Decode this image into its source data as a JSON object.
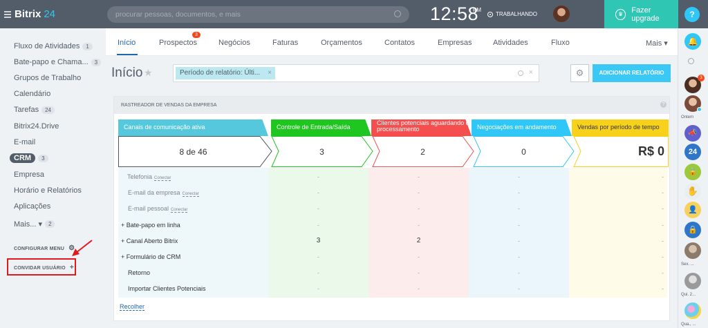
{
  "header": {
    "logo_text": "Bitrix",
    "logo_num": "24",
    "search_placeholder": "procurar pessoas, documentos, e mais",
    "time": "12:58",
    "ampm": "PM",
    "status": "TRABALHANDO",
    "upgrade_label": "Fazer upgrade",
    "help": "?"
  },
  "sidebar": {
    "items": [
      {
        "label": "Fluxo de Atividades",
        "count": "1"
      },
      {
        "label": "Bate-papo e Chama...",
        "count": "3"
      },
      {
        "label": "Grupos de Trabalho",
        "count": ""
      },
      {
        "label": "Calendário",
        "count": ""
      },
      {
        "label": "Tarefas",
        "count": "24"
      },
      {
        "label": "Bitrix24.Drive",
        "count": ""
      },
      {
        "label": "E-mail",
        "count": ""
      },
      {
        "label": "CRM",
        "count": "3"
      },
      {
        "label": "Empresa",
        "count": ""
      },
      {
        "label": "Horário e Relatórios",
        "count": ""
      },
      {
        "label": "Aplicações",
        "count": ""
      },
      {
        "label": "Mais... ▾",
        "count": "2"
      }
    ],
    "config_menu": "CONFIGURAR MENU",
    "invite_user": "CONVIDAR USUÁRIO"
  },
  "tabs": {
    "items": [
      "Início",
      "Prospectos",
      "Negócios",
      "Faturas",
      "Orçamentos",
      "Contatos",
      "Empresas",
      "Atividades",
      "Fluxo",
      "Mais ▾"
    ],
    "badge": "3"
  },
  "page": {
    "title": "Início",
    "filter_chip": "Período de relatório: Últi...",
    "add_report": "ADICIONAR RELATÓRIO"
  },
  "card": {
    "title": "RASTREADOR DE VENDAS DA EMPRESA",
    "help": "?",
    "stages": [
      {
        "name": "Canais de comunicação ativa",
        "value": "8 de 46",
        "color": "#55c8dd"
      },
      {
        "name": "Controle de Entrada/Saída",
        "value": "3",
        "color": "#1fc61f"
      },
      {
        "name": "Clientes potenciais aguardando o processamento",
        "value": "2",
        "color": "#f54e4e"
      },
      {
        "name": "Negociações em andamento",
        "value": "0",
        "color": "#2fc7f7"
      },
      {
        "name": "Vendas por período de tempo",
        "value": "R$ 0",
        "color": "#f8d21a"
      }
    ],
    "rows": [
      {
        "label": "Telefonia",
        "connect": "Conectar",
        "values": [
          "-",
          "-",
          "-",
          "-"
        ]
      },
      {
        "label": "E-mail da empresa",
        "connect": "Conectar",
        "values": [
          "-",
          "-",
          "-",
          "-"
        ]
      },
      {
        "label": "E-mail pessoal",
        "connect": "Conectar",
        "values": [
          "-",
          "-",
          "-",
          "-"
        ]
      },
      {
        "label": "+ Bate-papo em linha",
        "connect": "",
        "values": [
          "-",
          "-",
          "-",
          "-"
        ]
      },
      {
        "label": "+ Canal Aberto Bitrix",
        "connect": "",
        "values": [
          "3",
          "2",
          "-",
          "-"
        ]
      },
      {
        "label": "+ Formulário de CRM",
        "connect": "",
        "values": [
          "-",
          "-",
          "-",
          "-"
        ]
      },
      {
        "label": "Retorno",
        "connect": "",
        "values": [
          "-",
          "-",
          "-",
          "-"
        ]
      },
      {
        "label": "Importar Clientes Potenciais",
        "connect": "",
        "values": [
          "-",
          "-",
          "-",
          "-"
        ]
      }
    ],
    "collapse": "Recolher"
  },
  "rightbar": {
    "labels": [
      "Ontem",
      "Sex. ...",
      "Qui. 2...",
      "Qua., ..."
    ],
    "badge": "3"
  }
}
